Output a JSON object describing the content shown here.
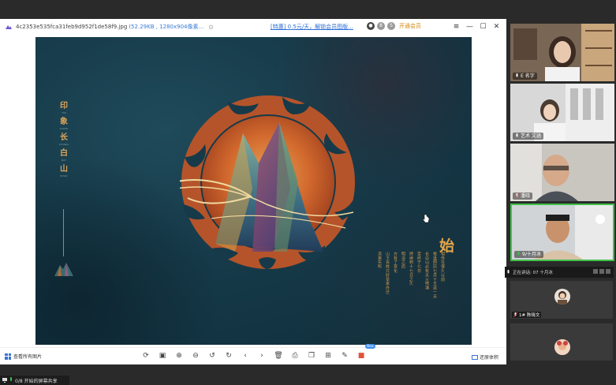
{
  "viewer": {
    "filename": "4c2353e535fca31feb9d952f1de58f9.jpg",
    "meta": "(52.29KB , 1280x904像素...",
    "promo": "[特惠] 0.5元/天，解锁会员图版...",
    "vip_label": "开通会员",
    "badge_b": "8",
    "badge_s": "S",
    "win_menu": "≡",
    "win_min": "—",
    "win_max": "☐",
    "win_close": "✕"
  },
  "artwork": {
    "title_chars": [
      {
        "char": "印",
        "pinyin": "YIN"
      },
      {
        "char": "象",
        "pinyin": "XIANG"
      },
      {
        "char": "长",
        "pinyin": "CHANG"
      },
      {
        "char": "白",
        "pinyin": "BAI"
      },
      {
        "char": "山",
        "pinyin": "SHAN"
      }
    ],
    "heading": "始",
    "poem_columns": [
      "相传在很久以前",
      "每逢阴历七月十五这一天",
      "长白山必有天火喷涌",
      "至终于七日",
      "持续到十七日之久",
      "明清之后",
      "方有了变化",
      "山下百姓只好举家外迁",
      "流离失所"
    ],
    "colors": {
      "accent": "#e3a548",
      "bg": "#163a49",
      "sun": "#d36a2e"
    }
  },
  "toolbar": {
    "view_all": "查看所有图片",
    "new_badge": "New",
    "restore": "还原体积",
    "tools": [
      "rotate-icon",
      "crop-icon",
      "zoom-in-icon",
      "zoom-out-icon",
      "rotate-left-icon",
      "rotate-right-icon",
      "prev-icon",
      "next-icon",
      "delete-icon",
      "print-icon",
      "copy-icon",
      "ocr-icon",
      "edit-icon",
      "app-icon"
    ]
  },
  "status": {
    "text": "0/8 开始的屏幕共享"
  },
  "participants": [
    {
      "name": "E 名字",
      "mic": "on"
    },
    {
      "name": "艺术 文涵",
      "mic": "on"
    },
    {
      "name": "潘晓",
      "mic": "off"
    },
    {
      "name": "9/十月冰",
      "mic": "on"
    }
  ],
  "speaking_tip": "正在讲话: 07 十月冰",
  "avatar_tiles": [
    {
      "name": "1# 陈晓文",
      "mic": "off"
    },
    {
      "name": "",
      "mic": ""
    }
  ]
}
